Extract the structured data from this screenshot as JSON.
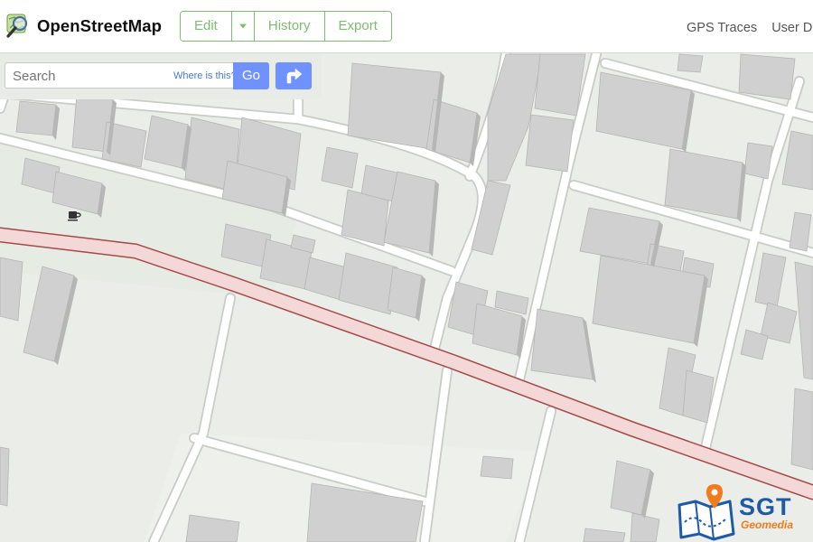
{
  "app": {
    "brand": "OpenStreetMap",
    "accent_color": "#7ebc6f",
    "search_button_color": "#7092ff"
  },
  "header": {
    "buttons": [
      {
        "label": "Edit"
      },
      {
        "label": "",
        "icon": "chevron-down-icon"
      },
      {
        "label": "History"
      },
      {
        "label": "Export"
      }
    ],
    "right_links": [
      "GPS Traces",
      "User Di"
    ]
  },
  "search": {
    "placeholder": "Search",
    "where_link": "Where is this?",
    "go_label": "Go",
    "directions_icon": "directions-icon"
  },
  "map": {
    "poi_icon": "cafe-icon",
    "main_road_color": "#f4d8d7",
    "main_road_casing": "#a44a48",
    "building_color": "#d0d0d0"
  },
  "watermark": {
    "title": "SGT",
    "subtitle": "Geomedia"
  }
}
